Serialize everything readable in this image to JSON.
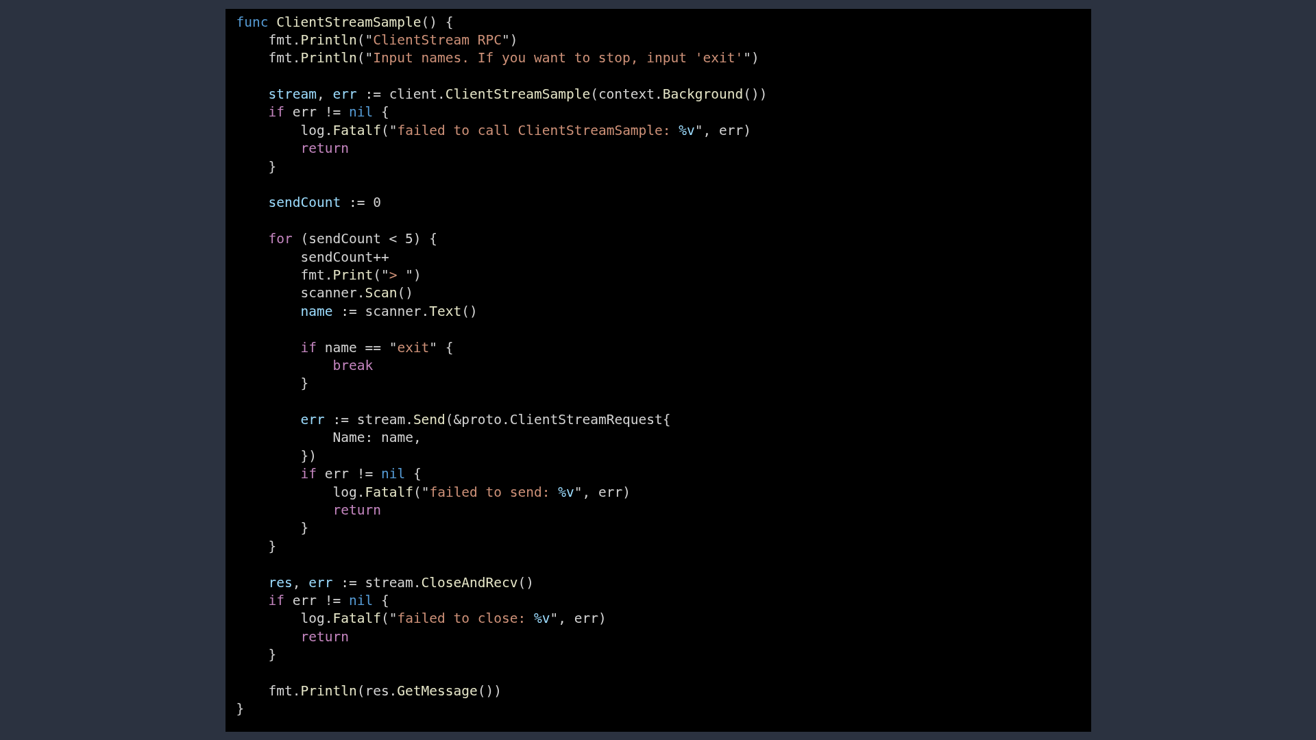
{
  "code": [
    {
      "kind": "code",
      "tokens": [
        {
          "text": "func",
          "kind": "keyword"
        },
        {
          "text": " ClientStreamSample",
          "kind": "function"
        },
        {
          "text": "() {",
          "kind": "plain"
        }
      ],
      "children": [
        {
          "kind": "code",
          "tokens": [
            {
              "text": "fmt.",
              "kind": "plain"
            },
            {
              "text": "Println",
              "kind": "function"
            },
            {
              "text": "(\"",
              "kind": "plain"
            },
            {
              "text": "ClientStream RPC",
              "kind": "string"
            },
            {
              "text": "\")",
              "kind": "plain"
            }
          ]
        },
        {
          "kind": "code",
          "tokens": [
            {
              "text": "fmt.",
              "kind": "plain"
            },
            {
              "text": "Println",
              "kind": "function"
            },
            {
              "text": "(\"",
              "kind": "plain"
            },
            {
              "text": "Input names. If you want to stop, input 'exit'",
              "kind": "string"
            },
            {
              "text": "\")",
              "kind": "plain"
            }
          ]
        },
        {
          "kind": "blank"
        },
        {
          "kind": "code",
          "tokens": [
            {
              "text": "stream",
              "kind": "variable"
            },
            {
              "text": ", ",
              "kind": "plain"
            },
            {
              "text": "err",
              "kind": "variable"
            },
            {
              "text": " := client.",
              "kind": "plain"
            },
            {
              "text": "ClientStreamSample",
              "kind": "function"
            },
            {
              "text": "(context.",
              "kind": "plain"
            },
            {
              "text": "Background",
              "kind": "function"
            },
            {
              "text": "())",
              "kind": "plain"
            }
          ]
        },
        {
          "kind": "code",
          "tokens": [
            {
              "text": "if",
              "kind": "control"
            },
            {
              "text": " err != ",
              "kind": "plain"
            },
            {
              "text": "nil",
              "kind": "keyword"
            },
            {
              "text": " {",
              "kind": "plain"
            }
          ],
          "children": [
            {
              "kind": "code",
              "tokens": [
                {
                  "text": "log.",
                  "kind": "plain"
                },
                {
                  "text": "Fatalf",
                  "kind": "function"
                },
                {
                  "text": "(\"",
                  "kind": "plain"
                },
                {
                  "text": "failed to call ClientStreamSample: ",
                  "kind": "string"
                },
                {
                  "text": "%v",
                  "kind": "format"
                },
                {
                  "text": "\", err)",
                  "kind": "plain"
                }
              ]
            },
            {
              "kind": "code",
              "tokens": [
                {
                  "text": "return",
                  "kind": "control"
                }
              ]
            }
          ]
        },
        {
          "kind": "code",
          "tokens": [
            {
              "text": "}",
              "kind": "plain"
            }
          ]
        },
        {
          "kind": "blank"
        },
        {
          "kind": "code",
          "tokens": [
            {
              "text": "sendCount",
              "kind": "variable"
            },
            {
              "text": " := ",
              "kind": "plain"
            },
            {
              "text": "0",
              "kind": "number"
            }
          ]
        },
        {
          "kind": "blank"
        },
        {
          "kind": "code",
          "tokens": [
            {
              "text": "for",
              "kind": "control"
            },
            {
              "text": " (sendCount < ",
              "kind": "plain"
            },
            {
              "text": "5",
              "kind": "number"
            },
            {
              "text": ") {",
              "kind": "plain"
            }
          ],
          "children": [
            {
              "kind": "code",
              "tokens": [
                {
                  "text": "sendCount++",
                  "kind": "plain"
                }
              ]
            },
            {
              "kind": "code",
              "tokens": [
                {
                  "text": "fmt.",
                  "kind": "plain"
                },
                {
                  "text": "Print",
                  "kind": "function"
                },
                {
                  "text": "(\"",
                  "kind": "plain"
                },
                {
                  "text": ">",
                  "kind": "string"
                },
                {
                  "text": " \")",
                  "kind": "plain"
                }
              ]
            },
            {
              "kind": "code",
              "tokens": [
                {
                  "text": "scanner.",
                  "kind": "plain"
                },
                {
                  "text": "Scan",
                  "kind": "function"
                },
                {
                  "text": "()",
                  "kind": "plain"
                }
              ]
            },
            {
              "kind": "code",
              "tokens": [
                {
                  "text": "name",
                  "kind": "variable"
                },
                {
                  "text": " := scanner.",
                  "kind": "plain"
                },
                {
                  "text": "Text",
                  "kind": "function"
                },
                {
                  "text": "()",
                  "kind": "plain"
                }
              ]
            },
            {
              "kind": "blank"
            },
            {
              "kind": "code",
              "tokens": [
                {
                  "text": "if",
                  "kind": "control"
                },
                {
                  "text": " name == \"",
                  "kind": "plain"
                },
                {
                  "text": "exit",
                  "kind": "string"
                },
                {
                  "text": "\" {",
                  "kind": "plain"
                }
              ],
              "children": [
                {
                  "kind": "code",
                  "tokens": [
                    {
                      "text": "break",
                      "kind": "control"
                    }
                  ]
                }
              ]
            },
            {
              "kind": "code",
              "tokens": [
                {
                  "text": "}",
                  "kind": "plain"
                }
              ]
            },
            {
              "kind": "blank"
            },
            {
              "kind": "code",
              "tokens": [
                {
                  "text": "err",
                  "kind": "variable"
                },
                {
                  "text": " := stream.",
                  "kind": "plain"
                },
                {
                  "text": "Send",
                  "kind": "function"
                },
                {
                  "text": "(&proto.ClientStreamRequest{",
                  "kind": "plain"
                }
              ],
              "children": [
                {
                  "kind": "code",
                  "tokens": [
                    {
                      "text": "Name: name,",
                      "kind": "plain"
                    }
                  ]
                }
              ]
            },
            {
              "kind": "code",
              "tokens": [
                {
                  "text": "})",
                  "kind": "plain"
                }
              ]
            },
            {
              "kind": "code",
              "tokens": [
                {
                  "text": "if",
                  "kind": "control"
                },
                {
                  "text": " err != ",
                  "kind": "plain"
                },
                {
                  "text": "nil",
                  "kind": "keyword"
                },
                {
                  "text": " {",
                  "kind": "plain"
                }
              ],
              "children": [
                {
                  "kind": "code",
                  "tokens": [
                    {
                      "text": "log.",
                      "kind": "plain"
                    },
                    {
                      "text": "Fatalf",
                      "kind": "function"
                    },
                    {
                      "text": "(\"",
                      "kind": "plain"
                    },
                    {
                      "text": "failed to send: ",
                      "kind": "string"
                    },
                    {
                      "text": "%v",
                      "kind": "format"
                    },
                    {
                      "text": "\", err)",
                      "kind": "plain"
                    }
                  ]
                },
                {
                  "kind": "code",
                  "tokens": [
                    {
                      "text": "return",
                      "kind": "control"
                    }
                  ]
                }
              ]
            },
            {
              "kind": "code",
              "tokens": [
                {
                  "text": "}",
                  "kind": "plain"
                }
              ]
            }
          ]
        },
        {
          "kind": "code",
          "tokens": [
            {
              "text": "}",
              "kind": "plain"
            }
          ]
        },
        {
          "kind": "blank"
        },
        {
          "kind": "code",
          "tokens": [
            {
              "text": "res",
              "kind": "variable"
            },
            {
              "text": ", ",
              "kind": "plain"
            },
            {
              "text": "err",
              "kind": "variable"
            },
            {
              "text": " := stream.",
              "kind": "plain"
            },
            {
              "text": "CloseAndRecv",
              "kind": "function"
            },
            {
              "text": "()",
              "kind": "plain"
            }
          ]
        },
        {
          "kind": "code",
          "tokens": [
            {
              "text": "if",
              "kind": "control"
            },
            {
              "text": " err != ",
              "kind": "plain"
            },
            {
              "text": "nil",
              "kind": "keyword"
            },
            {
              "text": " {",
              "kind": "plain"
            }
          ],
          "children": [
            {
              "kind": "code",
              "tokens": [
                {
                  "text": "log.",
                  "kind": "plain"
                },
                {
                  "text": "Fatalf",
                  "kind": "function"
                },
                {
                  "text": "(\"",
                  "kind": "plain"
                },
                {
                  "text": "failed to close: ",
                  "kind": "string"
                },
                {
                  "text": "%v",
                  "kind": "format"
                },
                {
                  "text": "\", err)",
                  "kind": "plain"
                }
              ]
            },
            {
              "kind": "code",
              "tokens": [
                {
                  "text": "return",
                  "kind": "control"
                }
              ]
            }
          ]
        },
        {
          "kind": "code",
          "tokens": [
            {
              "text": "}",
              "kind": "plain"
            }
          ]
        },
        {
          "kind": "blank"
        },
        {
          "kind": "code",
          "tokens": [
            {
              "text": "fmt.",
              "kind": "plain"
            },
            {
              "text": "Println",
              "kind": "function"
            },
            {
              "text": "(res.",
              "kind": "plain"
            },
            {
              "text": "GetMessage",
              "kind": "function"
            },
            {
              "text": "())",
              "kind": "plain"
            }
          ]
        }
      ]
    },
    {
      "kind": "code",
      "tokens": [
        {
          "text": "}",
          "kind": "plain"
        }
      ]
    }
  ]
}
